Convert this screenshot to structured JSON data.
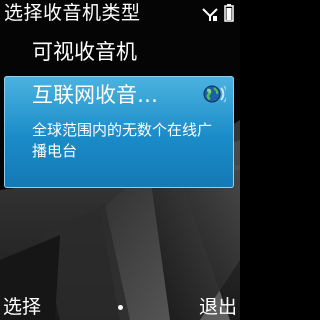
{
  "title_bar": {
    "title": "选择收音机类型",
    "icons": [
      "signal-antenna-icon",
      "battery-icon"
    ]
  },
  "menu": {
    "items": [
      {
        "label": "可视收音机",
        "selected": false
      },
      {
        "label": "互联网收音…",
        "description": "全球范围内的无数个在线广播电台",
        "icon": "globe-icon",
        "selected": true
      }
    ]
  },
  "softkeys": {
    "left": "选择",
    "right": "退出"
  },
  "colors": {
    "highlight": "#1a8bc8",
    "background": "#000000",
    "text": "#ffffff"
  }
}
